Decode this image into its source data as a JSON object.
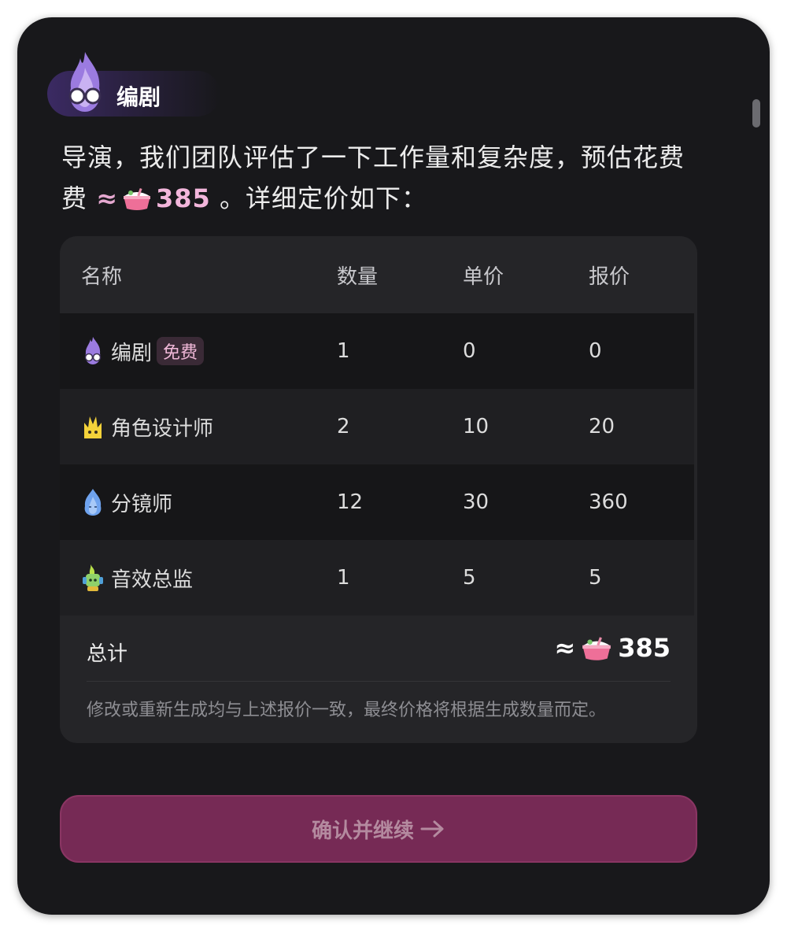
{
  "speaker": {
    "name": "编剧",
    "avatar_icon": "purple-flame-glasses-icon"
  },
  "message": {
    "before": "导演，我们团队评估了一下工作量和复杂度，预估花费",
    "approx": "≈",
    "amount": "385",
    "after": "。详细定价如下：",
    "currency_icon": "rice-bowl-icon"
  },
  "table": {
    "headers": {
      "name": "名称",
      "quantity": "数量",
      "unit_price": "单价",
      "quote": "报价"
    },
    "rows": [
      {
        "icon": "purple-flame-glasses-icon",
        "name": "编剧",
        "badge": "免费",
        "quantity": "1",
        "unit_price": "0",
        "quote": "0"
      },
      {
        "icon": "yellow-crown-flame-icon",
        "name": "角色设计师",
        "quantity": "2",
        "unit_price": "10",
        "quote": "20"
      },
      {
        "icon": "blue-flame-icon",
        "name": "分镜师",
        "quantity": "12",
        "unit_price": "30",
        "quote": "360"
      },
      {
        "icon": "green-headphone-robot-icon",
        "name": "音效总监",
        "quantity": "1",
        "unit_price": "5",
        "quote": "5"
      }
    ],
    "total": {
      "label": "总计",
      "approx": "≈",
      "amount": "385"
    },
    "note": "修改或重新生成均与上述报价一致，最终价格将根据生成数量而定。"
  },
  "confirm_button": {
    "label": "确认并继续"
  },
  "colors": {
    "card_bg": "#18181b",
    "table_bg": "#252528",
    "accent_pink": "#f3b6dc",
    "button_bg": "#762a55"
  }
}
